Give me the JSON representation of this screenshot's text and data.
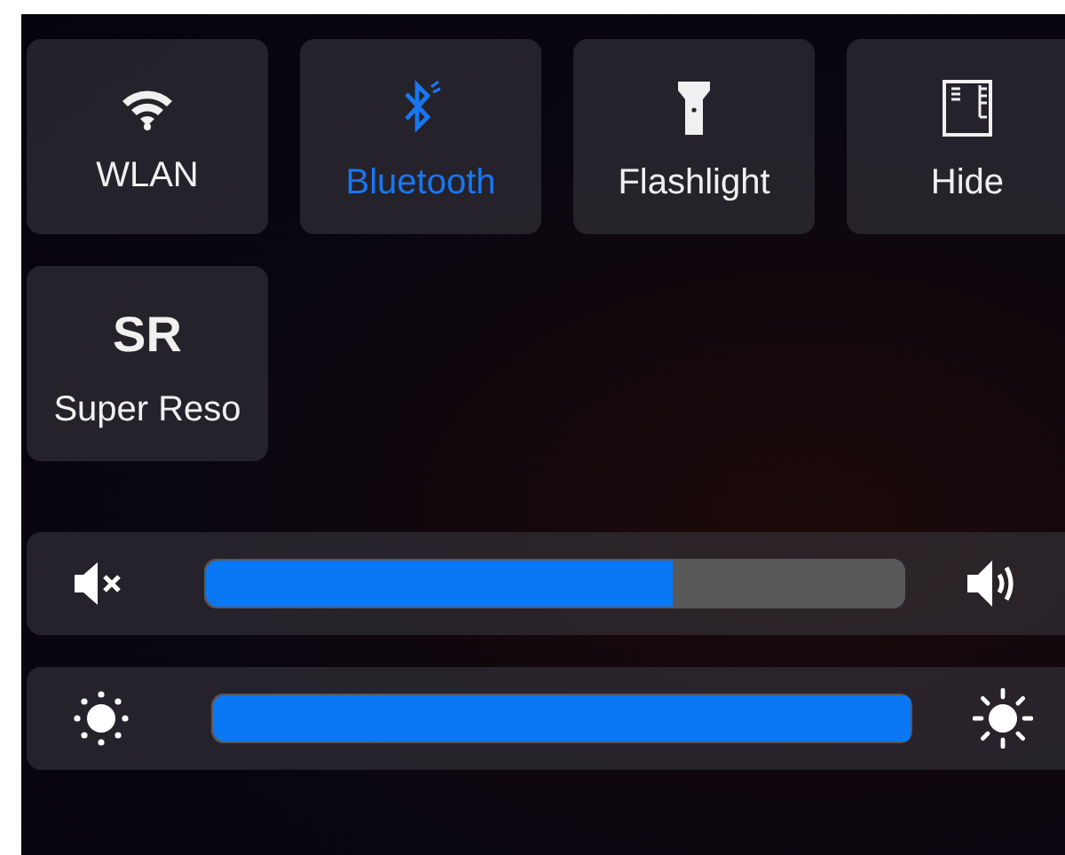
{
  "tiles": [
    {
      "kind": "wifi",
      "label": "WLAN",
      "on": false
    },
    {
      "kind": "bluetooth",
      "label": "Bluetooth",
      "on": true
    },
    {
      "kind": "flashlight",
      "label": "Flashlight",
      "on": false
    },
    {
      "kind": "hide",
      "label": "Hide",
      "on": false
    },
    {
      "kind": "text",
      "glyph": "SR",
      "label": "Super Reso",
      "on": false
    }
  ],
  "sliders": [
    {
      "kind": "volume",
      "level": 0.67
    },
    {
      "kind": "brightness",
      "level": 1.0
    }
  ]
}
